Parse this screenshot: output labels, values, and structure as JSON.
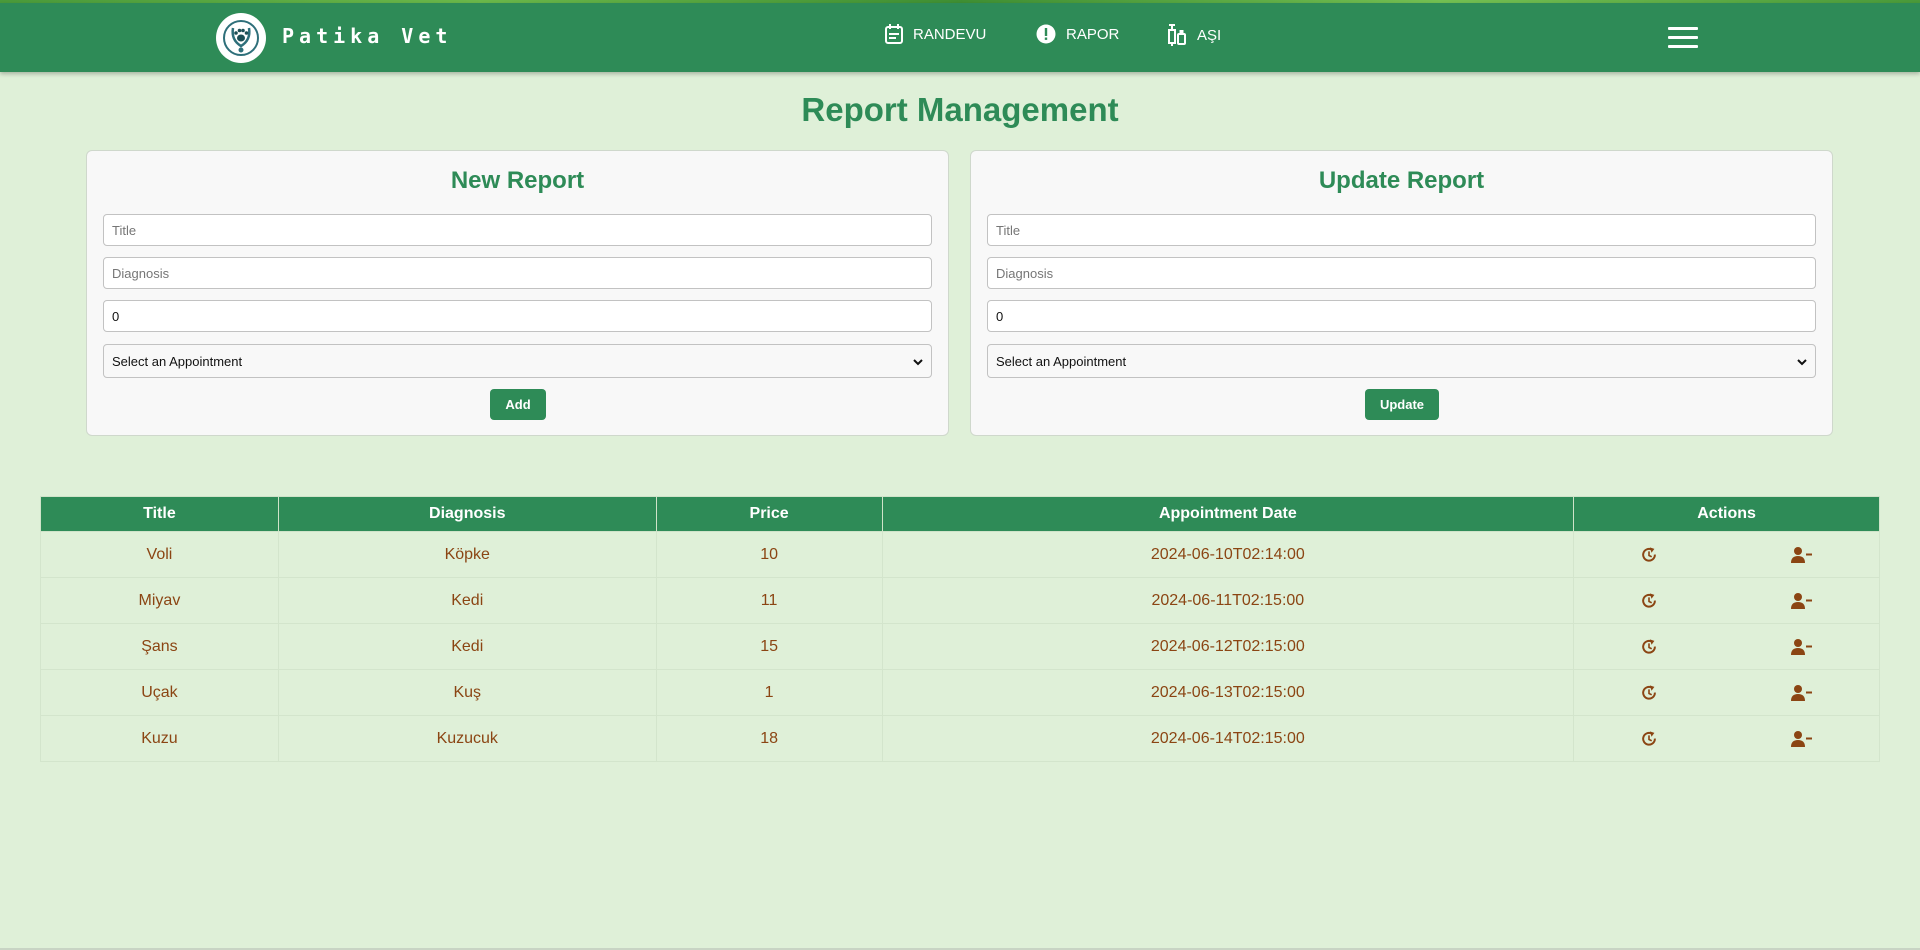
{
  "header": {
    "brand": "Patika Vet",
    "nav": [
      {
        "label": "RANDEVU",
        "icon": "calendar-icon"
      },
      {
        "label": "RAPOR",
        "icon": "alert-circle-icon"
      },
      {
        "label": "AŞI",
        "icon": "syringe-icon"
      }
    ],
    "menu_icon": "hamburger-menu-icon"
  },
  "page_title": "Report Management",
  "new_report": {
    "heading": "New Report",
    "title_placeholder": "Title",
    "diagnosis_placeholder": "Diagnosis",
    "price_value": "0",
    "appointment_select": "Select an Appointment",
    "submit_label": "Add"
  },
  "update_report": {
    "heading": "Update Report",
    "title_placeholder": "Title",
    "diagnosis_placeholder": "Diagnosis",
    "price_value": "0",
    "appointment_select": "Select an Appointment",
    "submit_label": "Update"
  },
  "table": {
    "columns": [
      "Title",
      "Diagnosis",
      "Price",
      "Appointment Date",
      "Actions"
    ],
    "rows": [
      {
        "title": "Voli",
        "diagnosis": "Köpke",
        "price": "10",
        "date": "2024-06-10T02:14:00"
      },
      {
        "title": "Miyav",
        "diagnosis": "Kedi",
        "price": "11",
        "date": "2024-06-11T02:15:00"
      },
      {
        "title": "Şans",
        "diagnosis": "Kedi",
        "price": "15",
        "date": "2024-06-12T02:15:00"
      },
      {
        "title": "Uçak",
        "diagnosis": "Kuş",
        "price": "1",
        "date": "2024-06-13T02:15:00"
      },
      {
        "title": "Kuzu",
        "diagnosis": "Kuzucuk",
        "price": "18",
        "date": "2024-06-14T02:15:00"
      }
    ],
    "action_icons": [
      "update-icon",
      "remove-user-icon"
    ]
  },
  "colors": {
    "primary": "#2e8b57",
    "background": "#dff0d8",
    "table_text": "#8b4513"
  }
}
